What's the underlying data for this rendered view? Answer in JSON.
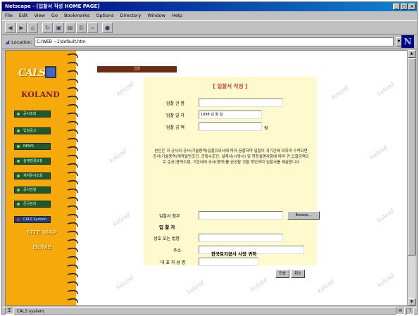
{
  "window": {
    "title": "Netscape - [입찰서 작성 HOME PAGE]",
    "controls": [
      "_",
      "□",
      "×"
    ]
  },
  "menu": [
    "File",
    "Edit",
    "View",
    "Go",
    "Bookmarks",
    "Options",
    "Directory",
    "Window",
    "Help"
  ],
  "toolbar": {
    "icons": [
      "back-icon",
      "forward-icon",
      "home-icon",
      "reload-icon",
      "images-icon",
      "open-icon",
      "print-icon",
      "find-icon",
      "stop-icon"
    ]
  },
  "location": {
    "label": "Location:",
    "value": "C:\\WEB ~1\\default.htm"
  },
  "status": {
    "text": "CALS system."
  },
  "sidebar": {
    "logo_text": "CALS",
    "brand": "KOLAND",
    "nav": [
      {
        "label": "공사조회"
      },
      {
        "label": "입찰공고"
      },
      {
        "label": "NEWS"
      },
      {
        "label": "설계변경요청"
      },
      {
        "label": "계약문서조회"
      },
      {
        "label": "공사진행"
      },
      {
        "label": "준공관리"
      },
      {
        "label": "CALS System"
      }
    ],
    "links": [
      "SITE MAP",
      "HOME"
    ]
  },
  "main": {
    "tab_header": "입찰",
    "watermark": "koland",
    "form": {
      "title": "[ 입찰서 작성 ]",
      "fields": [
        {
          "label": "입찰 건 명",
          "value": ""
        },
        {
          "label": "입찰 일 자",
          "value": "1998 년   월   일"
        },
        {
          "label": "입찰 금 액",
          "value": "",
          "suffix": "원"
        }
      ],
      "paragraph": "본인은 귀 공사의 공사(기술용역)입찰유의서에 따라 응찰하며 입찰이 귀기관에 의하여 수락되면 공사(기술용역)계약일반조건, 공특수조건, 설계서(시방서) 및 현장설명사항에 따라 귀 입찰금액으로 준공(용역수행, 기한내에 공사(용역)를 완성할 것을 확인하며 입찰서를 제출합니다",
      "attach_label": "입찰서 첨부",
      "browse_label": "Browse...",
      "bidder_header": "입 찰 자",
      "bidder_fields": [
        {
          "label": "상호 또는 법명",
          "value": ""
        },
        {
          "label": "주소",
          "value": ""
        },
        {
          "label": "대 표 자 성 명",
          "value": ""
        }
      ],
      "recipient": "한국토지공사 사장 귀하"
    },
    "buttons": {
      "submit": "전송",
      "cancel": "취소"
    }
  }
}
